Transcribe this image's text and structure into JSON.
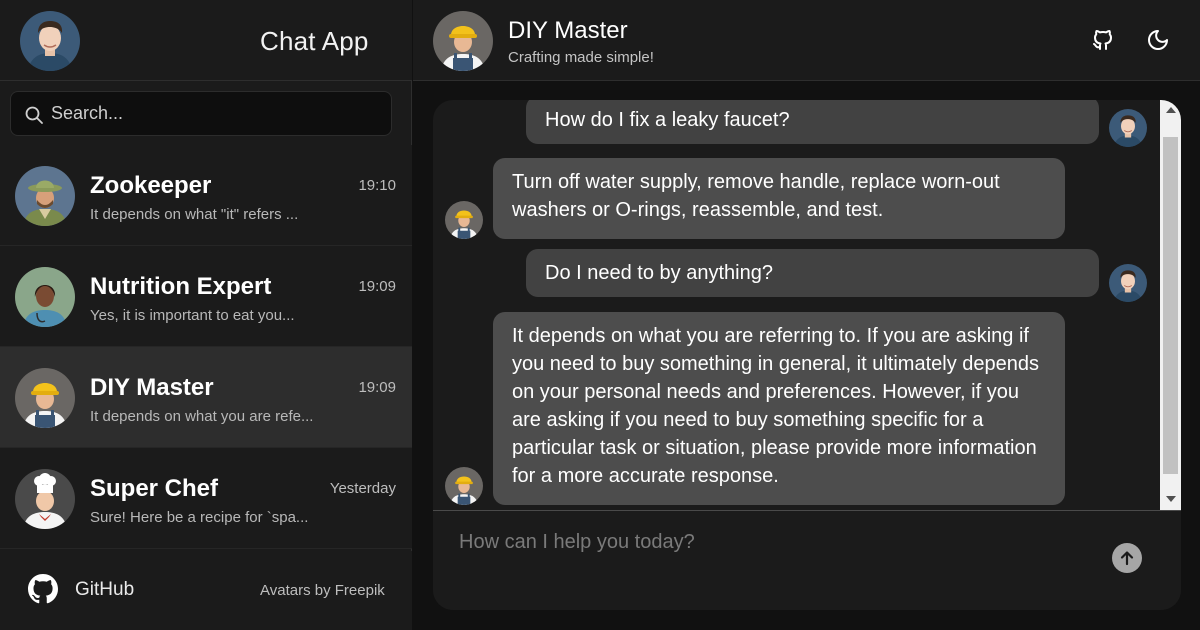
{
  "app": {
    "title": "Chat App"
  },
  "search": {
    "placeholder": "Search..."
  },
  "conversations": [
    {
      "name": "Zookeeper",
      "time": "19:10",
      "preview": "It depends on what \"it\" refers ...",
      "avatar": "zookeeper-avatar"
    },
    {
      "name": "Nutrition Expert",
      "time": "19:09",
      "preview": "Yes, it is important to eat you...",
      "avatar": "nutrition-expert-avatar"
    },
    {
      "name": "DIY Master",
      "time": "19:09",
      "preview": "It depends on what you are refe...",
      "avatar": "diy-master-avatar",
      "active": true
    },
    {
      "name": "Super Chef",
      "time": "Yesterday",
      "preview": "Sure! Here be a recipe for `spa...",
      "avatar": "super-chef-avatar"
    }
  ],
  "footer": {
    "github_label": "GitHub",
    "credit": "Avatars by Freepik"
  },
  "chat": {
    "name": "DIY Master",
    "subtitle": "Crafting made simple!",
    "messages": [
      {
        "role": "user",
        "text": "How do I fix a leaky faucet?"
      },
      {
        "role": "bot",
        "text": "Turn off water supply, remove handle, replace worn-out washers or O-rings, reassemble, and test."
      },
      {
        "role": "user",
        "text": "Do I need to by anything?"
      },
      {
        "role": "bot",
        "text": "It depends on what you are referring to. If you are asking if you need to buy something in general, it ultimately depends on your personal needs and preferences. However, if you are asking if you need to buy something specific for a particular task or situation, please provide more information for a more accurate response."
      }
    ],
    "input_placeholder": "How can I help you today?"
  },
  "icons": {
    "search": "search-icon",
    "github": "github-icon",
    "theme": "moon-icon",
    "send": "arrow-up-icon"
  },
  "colors": {
    "sidebar_bg": "#1b1b1b",
    "active_item_bg": "#2d2d2d",
    "bot_bubble": "#4d4d4d",
    "user_bubble": "#424242",
    "send_button": "#a6a6a6"
  }
}
